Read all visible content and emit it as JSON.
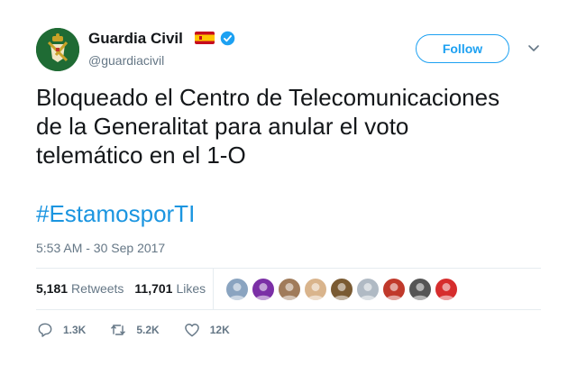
{
  "account": {
    "display_name": "Guardia Civil",
    "handle": "@guardiacivil",
    "flag_icon": "spain-flag-icon",
    "verified_icon": "verified-badge-icon",
    "brand_color": "#1f6b34"
  },
  "follow_button": {
    "label": "Follow"
  },
  "tweet": {
    "lines": [
      "Bloqueado el Centro de Telecomunicaciones",
      "de la Generalitat para anular el voto",
      "telemático en el 1-O"
    ],
    "hashtag": "#EstamosporTI",
    "timestamp": "5:53 AM - 30 Sep 2017"
  },
  "stats": {
    "retweets_count": "5,181",
    "retweets_label": "Retweets",
    "likes_count": "11,701",
    "likes_label": "Likes"
  },
  "likers": [
    {
      "color": "#8aa4c0"
    },
    {
      "color": "#7b2fa6"
    },
    {
      "color": "#a07b5a"
    },
    {
      "color": "#d9b48c"
    },
    {
      "color": "#7a5a32"
    },
    {
      "color": "#b0bac4"
    },
    {
      "color": "#c0392b"
    },
    {
      "color": "#555555"
    },
    {
      "color": "#d62d2d"
    }
  ],
  "actions": {
    "reply_count": "1.3K",
    "retweet_count": "5.2K",
    "like_count": "12K"
  },
  "colors": {
    "accent": "#1da1f2",
    "hashtag": "#1b95e0",
    "muted": "#657786",
    "text": "#14171a"
  }
}
